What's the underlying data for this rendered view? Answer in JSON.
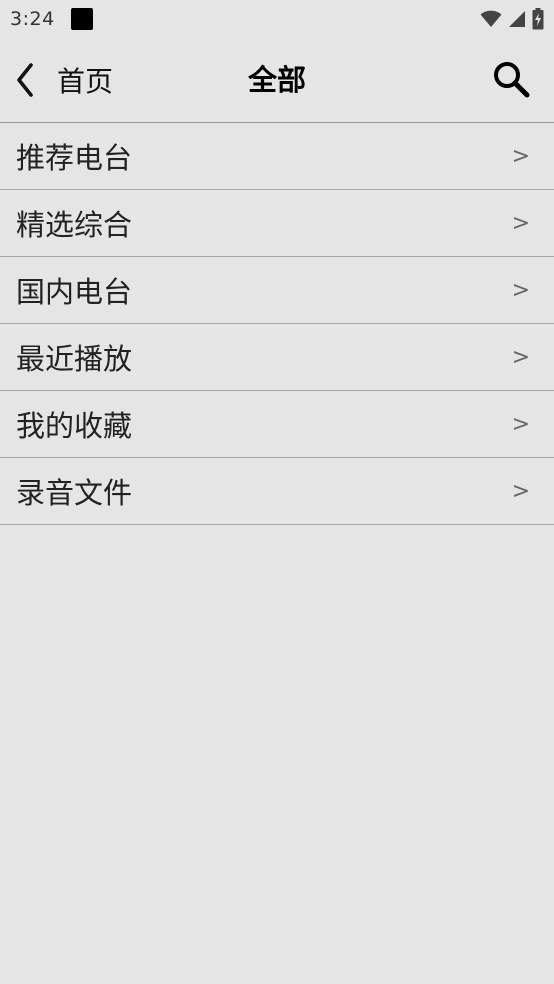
{
  "status_bar": {
    "time": "3:24",
    "icons": [
      "notification-square-icon",
      "wifi-icon",
      "signal-icon",
      "battery-charging-icon"
    ]
  },
  "header": {
    "back_icon": "chevron-left-icon",
    "back_label": "首页",
    "title": "全部",
    "search_icon": "search-icon"
  },
  "menu": {
    "items": [
      {
        "label": "推荐电台",
        "arrow": ">"
      },
      {
        "label": "精选综合",
        "arrow": ">"
      },
      {
        "label": "国内电台",
        "arrow": ">"
      },
      {
        "label": "最近播放",
        "arrow": ">"
      },
      {
        "label": "我的收藏",
        "arrow": ">"
      },
      {
        "label": "录音文件",
        "arrow": ">"
      }
    ]
  }
}
